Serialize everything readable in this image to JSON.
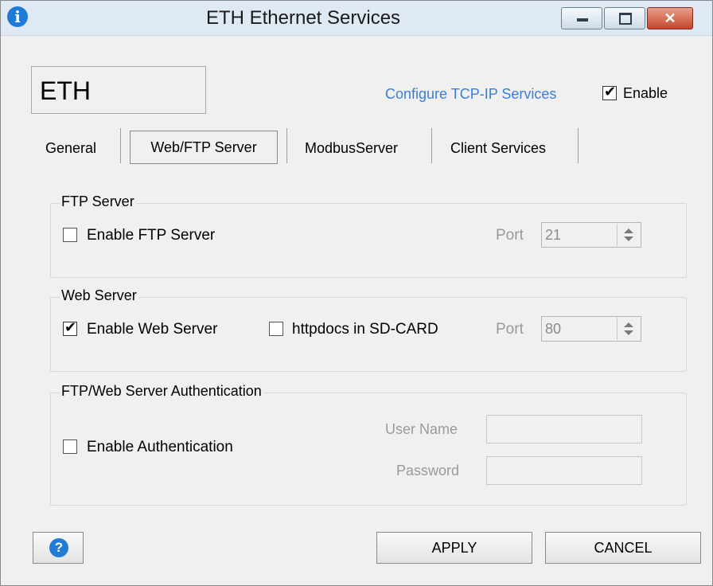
{
  "window": {
    "title": "ETH Ethernet Services",
    "title_icon": "info-icon",
    "controls": {
      "close_glyph": "✕"
    }
  },
  "header": {
    "name": "ETH",
    "configure_link": "Configure TCP-IP Services",
    "enable_label": "Enable",
    "enable_checked": true
  },
  "tabs": [
    {
      "label": "General"
    },
    {
      "label": "Web/FTP Server",
      "active": true
    },
    {
      "label": "ModbusServer"
    },
    {
      "label": "Client Services"
    }
  ],
  "ftp_server": {
    "title": "FTP Server",
    "enable_label": "Enable FTP Server",
    "enabled": false,
    "port_label": "Port",
    "port_value": "21"
  },
  "web_server": {
    "title": "Web Server",
    "enable_label": "Enable Web Server",
    "enabled": true,
    "sdcard_label": "httpdocs in SD-CARD",
    "sdcard_checked": false,
    "port_label": "Port",
    "port_value": "80"
  },
  "auth": {
    "title": "FTP/Web Server Authentication",
    "enable_label": "Enable Authentication",
    "enabled": false,
    "username_label": "User Name",
    "username_value": "",
    "password_label": "Password",
    "password_value": ""
  },
  "footer": {
    "help_glyph": "?",
    "apply_label": "APPLY",
    "cancel_label": "CANCEL"
  },
  "colors": {
    "link": "#3a7dd8",
    "titlebar": "#dfe9f4",
    "dialog_bg": "#f0f0f0",
    "close_button": "#c7452b",
    "info_icon": "#1f7bd4"
  }
}
